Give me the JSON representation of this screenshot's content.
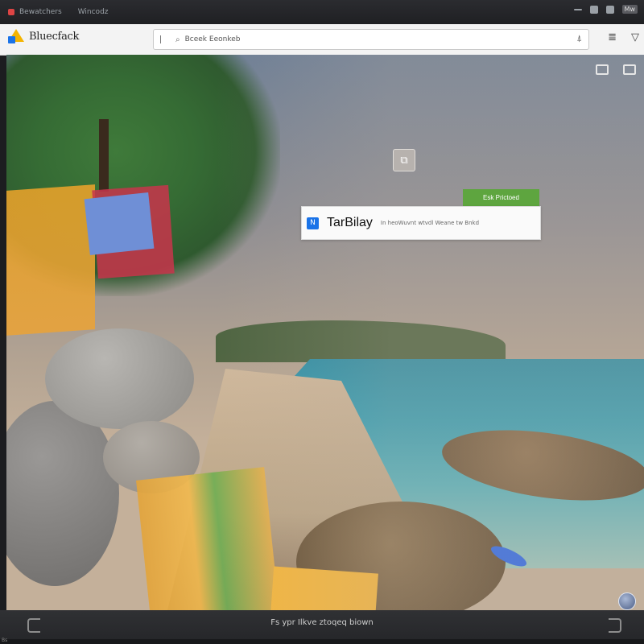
{
  "window": {
    "tabs": [
      {
        "label": "Bewatchers"
      },
      {
        "label": "Wincodz"
      }
    ],
    "badge": "Mw"
  },
  "toolbar": {
    "brand": "Bluecfack",
    "url_text": "Bceek Eeonkeb",
    "url_search_icon": "search-icon",
    "url_right_icon": "reader-icon",
    "menu_icon": "menu-icon",
    "filter_icon": "filter-icon"
  },
  "overlay": {
    "button_label": "Esk Prictoed",
    "dialog_title": "TarBilay",
    "dialog_text": "In heoWuvnt wtvdl Weane tw Bnkd",
    "dialog_icon": "N"
  },
  "bottombar": {
    "text": "Fs ypr Ilkve ztoqeq biown"
  },
  "statusbar": {
    "text": "Bs"
  },
  "colors": {
    "accent_green": "#5ea53f",
    "accent_blue": "#1a73e8"
  }
}
